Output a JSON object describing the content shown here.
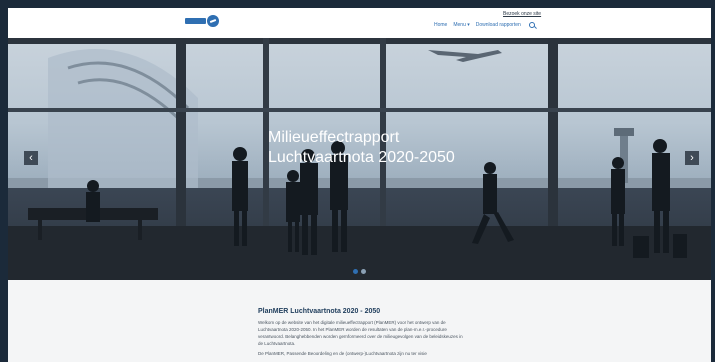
{
  "header": {
    "skip_link": "Bezoek onze site",
    "nav": {
      "home": "Home",
      "menu": "Menu ▾",
      "download": "Download rapporten"
    }
  },
  "hero": {
    "title": "Milieueffectrapport Luchtvaartnota 2020-2050",
    "prev_label": "‹",
    "next_label": "›",
    "slide_count": 2,
    "active_slide": 1
  },
  "main": {
    "title": "PlanMER Luchtvaartnota 2020 - 2050",
    "paragraphs": [
      "Welkom op de website van het digitale milieueffectrapport (PlanMER) voor het ontwerp van de Luchtvaartnota 2020-2050. In het PlanMER worden de resultaten van de plan-m.e.r.-procedure verantwoord. Belanghebbenden worden geïnformeerd over de milieugevolgen van de beleidskeuzes in de Luchtvaartnota.",
      "De PlanMER, Passende Beoordeling en de (ontwerp-)Luchtvaartnota zijn nu ter visie"
    ]
  },
  "colors": {
    "brand_blue": "#2f6fb2",
    "title_navy": "#1f3d5c",
    "frame_bg": "#1b2a3a"
  }
}
